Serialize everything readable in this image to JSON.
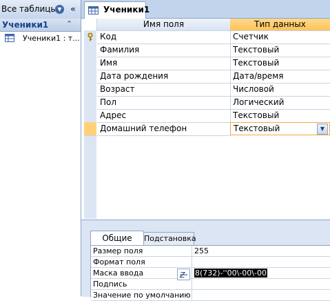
{
  "nav": {
    "title": "Все таблицы",
    "group": "Ученики1",
    "item": "Ученики1 : т..."
  },
  "tab": {
    "label": "Ученики1"
  },
  "grid": {
    "headers": {
      "name": "Имя поля",
      "type": "Тип данных"
    },
    "rows": [
      {
        "name": "Код",
        "type": "Счетчик"
      },
      {
        "name": "Фамилия",
        "type": "Текстовый"
      },
      {
        "name": "Имя",
        "type": "Текстовый"
      },
      {
        "name": "Дата рождения",
        "type": "Дата/время"
      },
      {
        "name": "Возраст",
        "type": "Числовой"
      },
      {
        "name": "Пол",
        "type": "Логический"
      },
      {
        "name": "Адрес",
        "type": "Текстовый"
      },
      {
        "name": "Домашний телефон",
        "type": "Текстовый"
      }
    ]
  },
  "props": {
    "tabs": {
      "general": "Общие",
      "lookup": "Подстановка"
    },
    "rows": [
      {
        "label": "Размер поля",
        "value": "255"
      },
      {
        "label": "Формат поля",
        "value": ""
      },
      {
        "label": "Маска ввода",
        "value": "8(732)-''00\\-00\\-00"
      },
      {
        "label": "Подпись",
        "value": ""
      },
      {
        "label": "Значение по умолчанию",
        "value": ""
      }
    ]
  },
  "colors": {
    "accent": "#ffc35a",
    "panel": "#dbe5f3",
    "border": "#8da4c6"
  }
}
